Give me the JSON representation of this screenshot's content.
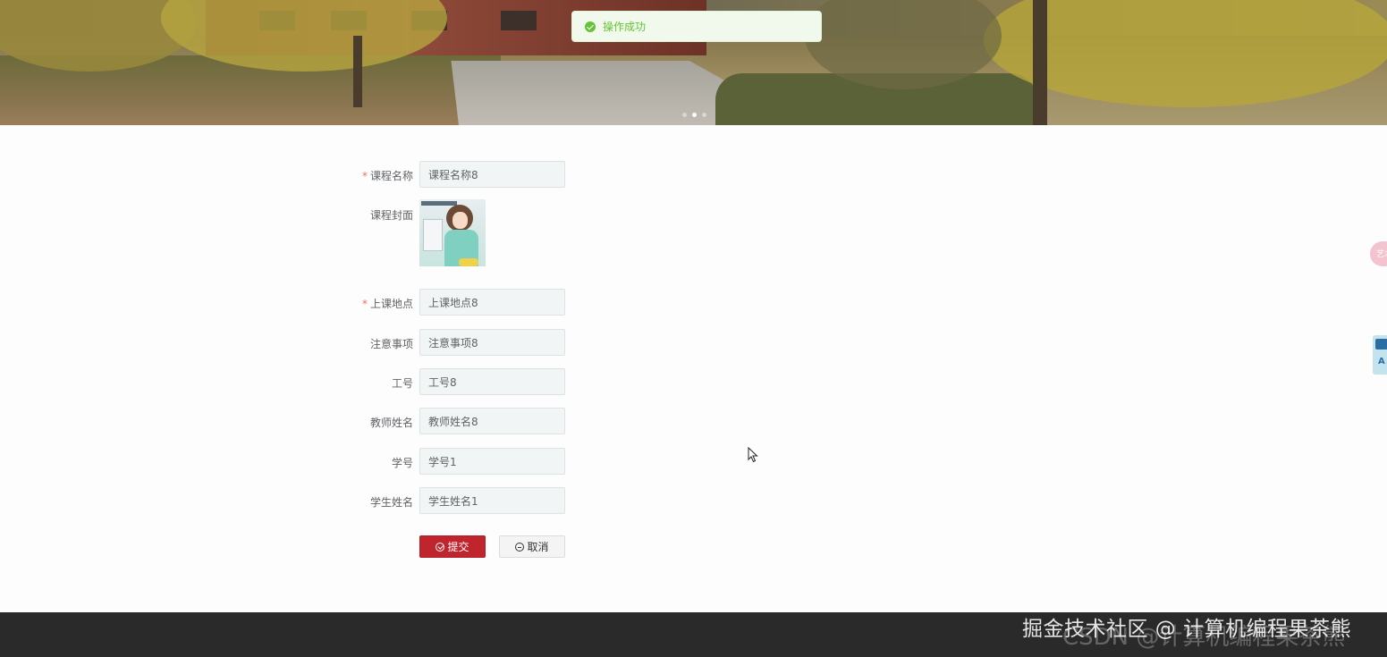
{
  "toast": {
    "message": "操作成功",
    "icon": "success-check-icon",
    "color": "#67c23a"
  },
  "banner": {
    "slides": 3,
    "active_slide": 2
  },
  "form": {
    "fields": [
      {
        "label": "课程名称",
        "required": true,
        "value": "课程名称8"
      },
      {
        "label": "课程封面",
        "required": false,
        "type": "image"
      },
      {
        "label": "上课地点",
        "required": true,
        "value": "上课地点8"
      },
      {
        "label": "注意事项",
        "required": false,
        "value": "注意事项8"
      },
      {
        "label": "工号",
        "required": false,
        "value": "工号8"
      },
      {
        "label": "教师姓名",
        "required": false,
        "value": "教师姓名8"
      },
      {
        "label": "学号",
        "required": false,
        "value": "学号1"
      },
      {
        "label": "学生姓名",
        "required": false,
        "value": "学生姓名1"
      }
    ],
    "required_mark": "*",
    "submit_label": "提交",
    "cancel_label": "取消",
    "submit_color": "#c0252e"
  },
  "side": {
    "pink_label": "艺术"
  },
  "watermark": {
    "primary": "掘金技术社区 @ 计算机编程果茶熊",
    "secondary": "CSDN @计算机编程果茶熊"
  }
}
